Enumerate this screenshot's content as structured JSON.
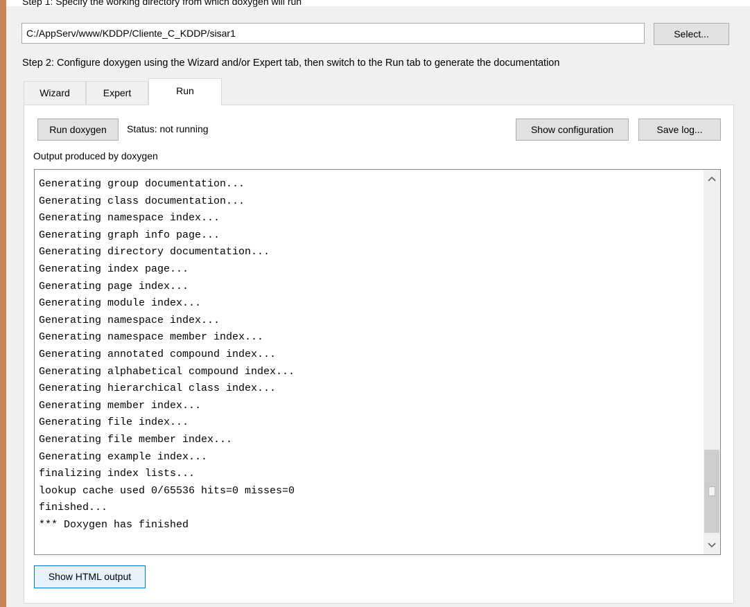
{
  "step1": {
    "label": "Step 1: Specify the working directory from which doxygen will run",
    "working_dir": "C:/AppServ/www/KDDP/Cliente_C_KDDP/sisar1",
    "select_label": "Select..."
  },
  "step2": {
    "label": "Step 2: Configure doxygen using the Wizard and/or Expert tab, then switch to the Run tab to generate the documentation"
  },
  "tabs": [
    {
      "label": "Wizard",
      "active": false
    },
    {
      "label": "Expert",
      "active": false
    },
    {
      "label": "Run",
      "active": true
    }
  ],
  "run": {
    "run_button": "Run doxygen",
    "status": "Status: not running",
    "show_config_button": "Show configuration",
    "save_log_button": "Save log...",
    "output_label": "Output produced by doxygen",
    "log_lines": [
      "Generating group documentation...",
      "Generating class documentation...",
      "Generating namespace index...",
      "Generating graph info page...",
      "Generating directory documentation...",
      "Generating index page...",
      "Generating page index...",
      "Generating module index...",
      "Generating namespace index...",
      "Generating namespace member index...",
      "Generating annotated compound index...",
      "Generating alphabetical compound index...",
      "Generating hierarchical class index...",
      "Generating member index...",
      "Generating file index...",
      "Generating file member index...",
      "Generating example index...",
      "finalizing index lists...",
      "lookup cache used 0/65536 hits=0 misses=0",
      "finished...",
      "*** Doxygen has finished"
    ],
    "show_html_button": "Show HTML output"
  },
  "icons": {
    "scroll_up": "chevron-up-icon",
    "scroll_down": "chevron-down-icon"
  },
  "colors": {
    "window_border": "#c6865a",
    "focus_accent": "#0078d7"
  }
}
